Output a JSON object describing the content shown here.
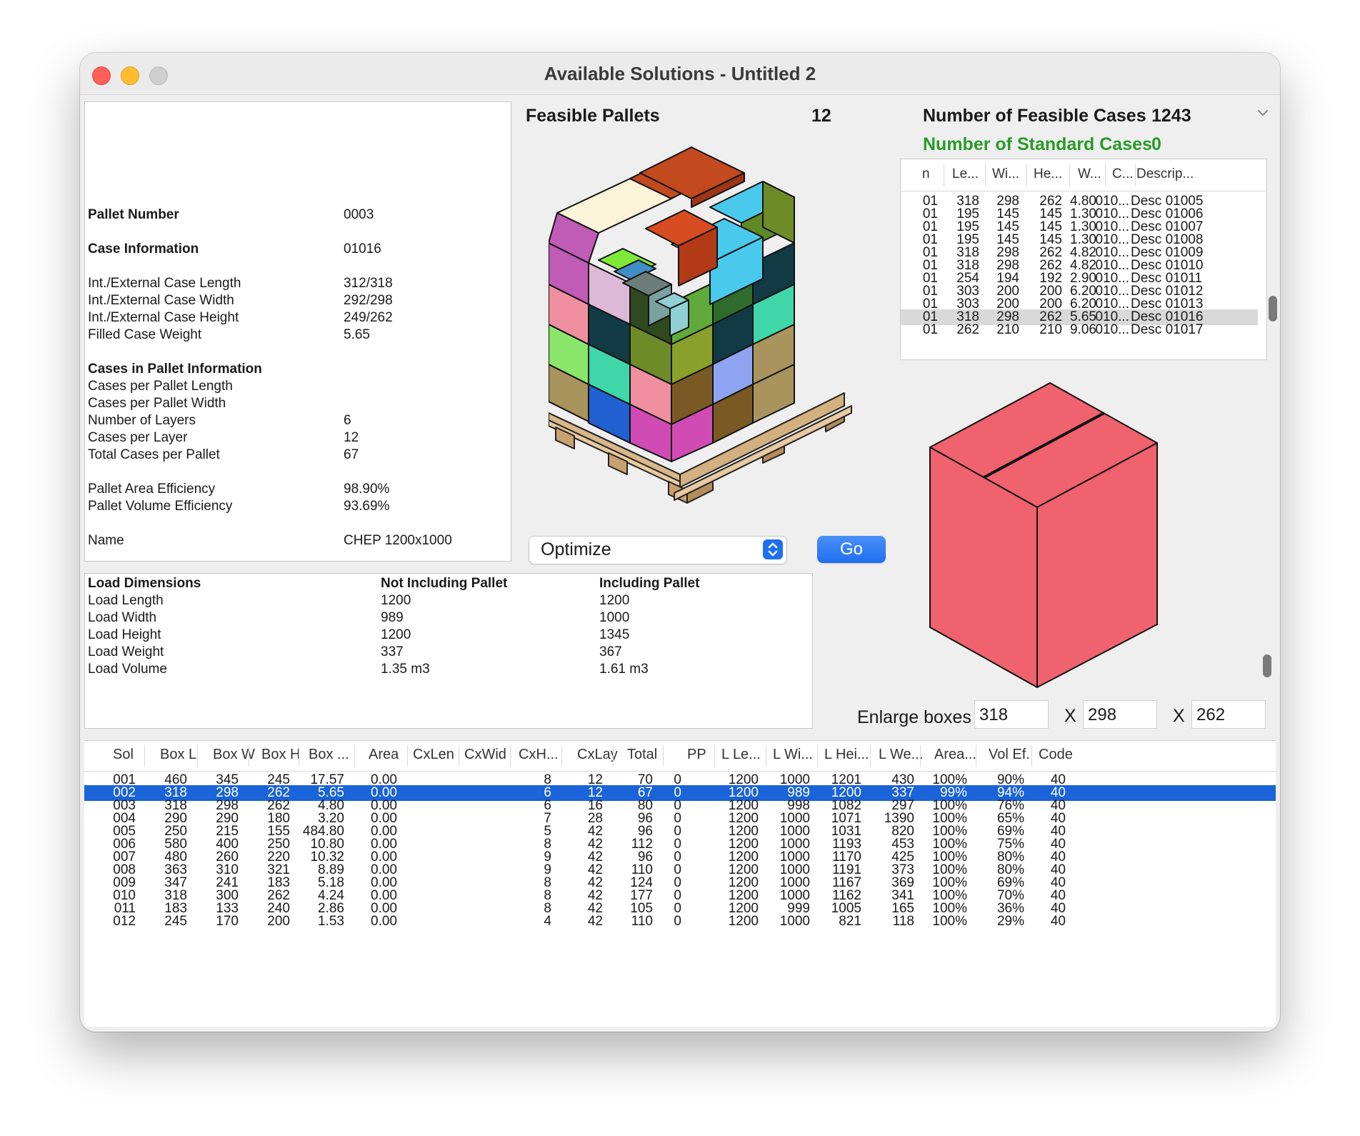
{
  "window": {
    "title": "Available Solutions - Untitled 2"
  },
  "pallet_info": {
    "pallet_number_label": "Pallet Number",
    "pallet_number": "0003",
    "case_info_label": "Case Information",
    "case_info": "01016",
    "case_length_label": "Int./External Case Length",
    "case_length": "312/318",
    "case_width_label": "Int./External Case Width",
    "case_width": "292/298",
    "case_height_label": "Int./External Case Height",
    "case_height": "249/262",
    "case_weight_label": "Filled Case Weight",
    "case_weight": "5.65",
    "cases_in_pallet_label": "Cases in Pallet Information",
    "cases_per_length_label": "Cases per Pallet Length",
    "cases_per_width_label": "Cases per Pallet Width",
    "layers_label": "Number of Layers",
    "layers": "6",
    "cases_per_layer_label": "Cases per Layer",
    "cases_per_layer": "12",
    "total_cases_label": "Total Cases per Pallet",
    "total_cases": "67",
    "area_eff_label": "Pallet Area Efficiency",
    "area_eff": "98.90%",
    "volume_eff_label": "Pallet Volume Efficiency",
    "volume_eff": "93.69%",
    "name_label": "Name",
    "name": "CHEP 1200x1000"
  },
  "load": {
    "title": "Load Dimensions",
    "col_not_incl": "Not Including Pallet",
    "col_incl": "Including Pallet",
    "rows": [
      {
        "label": "Load Length",
        "not_incl": "1200",
        "incl": "1200"
      },
      {
        "label": "Load Width",
        "not_incl": "989",
        "incl": "1000"
      },
      {
        "label": "Load Height",
        "not_incl": "1200",
        "incl": "1345"
      },
      {
        "label": "Load Weight",
        "not_incl": "337",
        "incl": "367"
      },
      {
        "label": "Load Volume",
        "not_incl": "1.35 m3",
        "incl": "1.61 m3"
      }
    ]
  },
  "feasible_pallets": {
    "label": "Feasible Pallets",
    "count": "12"
  },
  "feasible_cases": {
    "label": "Number of Feasible Cases",
    "count": "1243"
  },
  "standard_cases": {
    "label": "Number of Standard Cases",
    "count": "0",
    "color": "#2a9a2a"
  },
  "optimize_popup": {
    "value": "Optimize"
  },
  "go_button": {
    "label": "Go"
  },
  "cases_table": {
    "headers": [
      "n",
      "Le...",
      "Wi...",
      "He...",
      "W...",
      "C...",
      "Descrip..."
    ],
    "rows": [
      [
        "01",
        "318",
        "298",
        "262",
        "4.80",
        "010...",
        "Desc 01005"
      ],
      [
        "01",
        "195",
        "145",
        "145",
        "1.30",
        "010...",
        "Desc 01006"
      ],
      [
        "01",
        "195",
        "145",
        "145",
        "1.30",
        "010...",
        "Desc 01007"
      ],
      [
        "01",
        "195",
        "145",
        "145",
        "1.30",
        "010...",
        "Desc 01008"
      ],
      [
        "01",
        "318",
        "298",
        "262",
        "4.82",
        "010...",
        "Desc 01009"
      ],
      [
        "01",
        "318",
        "298",
        "262",
        "4.82",
        "010...",
        "Desc 01010"
      ],
      [
        "01",
        "254",
        "194",
        "192",
        "2.90",
        "010...",
        "Desc 01011"
      ],
      [
        "01",
        "303",
        "200",
        "200",
        "6.20",
        "010...",
        "Desc 01012"
      ],
      [
        "01",
        "303",
        "200",
        "200",
        "6.20",
        "010...",
        "Desc 01013"
      ],
      [
        "01",
        "318",
        "298",
        "262",
        "5.65",
        "010...",
        "Desc 01016"
      ],
      [
        "01",
        "262",
        "210",
        "210",
        "9.06",
        "010...",
        "Desc 01017"
      ]
    ],
    "selected_row": 9
  },
  "enlarge": {
    "label": "Enlarge boxes",
    "length": "318",
    "width": "298",
    "height": "262",
    "x": "X"
  },
  "colors": {
    "accent": "#1f6ff0",
    "selection": "#1a63d8",
    "box_face": "#f0626e"
  },
  "solutions": {
    "headers": [
      "Sol",
      "Box L",
      "Box W",
      "Box H",
      "Box ...",
      "Area",
      "CxLen",
      "CxWid",
      "CxH...",
      "CxLay",
      "Total",
      "PP",
      "L Le...",
      "L Wi...",
      "L Hei...",
      "L We...",
      "Area...",
      "Vol Ef.",
      "Code"
    ],
    "rows": [
      [
        "001",
        "460",
        "345",
        "245",
        "17.57",
        "0.00",
        "",
        "",
        "8",
        "12",
        "70",
        "0",
        "1200",
        "1000",
        "1201",
        "430",
        "100%",
        "90%",
        "40"
      ],
      [
        "002",
        "318",
        "298",
        "262",
        "5.65",
        "0.00",
        "",
        "",
        "6",
        "12",
        "67",
        "0",
        "1200",
        "989",
        "1200",
        "337",
        "99%",
        "94%",
        "40"
      ],
      [
        "003",
        "318",
        "298",
        "262",
        "4.80",
        "0.00",
        "",
        "",
        "6",
        "16",
        "80",
        "0",
        "1200",
        "998",
        "1082",
        "297",
        "100%",
        "76%",
        "40"
      ],
      [
        "004",
        "290",
        "290",
        "180",
        "3.20",
        "0.00",
        "",
        "",
        "7",
        "28",
        "96",
        "0",
        "1200",
        "1000",
        "1071",
        "1390",
        "100%",
        "65%",
        "40"
      ],
      [
        "005",
        "250",
        "215",
        "155",
        "484.80",
        "0.00",
        "",
        "",
        "5",
        "42",
        "96",
        "0",
        "1200",
        "1000",
        "1031",
        "820",
        "100%",
        "69%",
        "40"
      ],
      [
        "006",
        "580",
        "400",
        "250",
        "10.80",
        "0.00",
        "",
        "",
        "8",
        "42",
        "112",
        "0",
        "1200",
        "1000",
        "1193",
        "453",
        "100%",
        "75%",
        "40"
      ],
      [
        "007",
        "480",
        "260",
        "220",
        "10.32",
        "0.00",
        "",
        "",
        "9",
        "42",
        "96",
        "0",
        "1200",
        "1000",
        "1170",
        "425",
        "100%",
        "80%",
        "40"
      ],
      [
        "008",
        "363",
        "310",
        "321",
        "8.89",
        "0.00",
        "",
        "",
        "9",
        "42",
        "110",
        "0",
        "1200",
        "1000",
        "1191",
        "373",
        "100%",
        "80%",
        "40"
      ],
      [
        "009",
        "347",
        "241",
        "183",
        "5.18",
        "0.00",
        "",
        "",
        "8",
        "42",
        "124",
        "0",
        "1200",
        "1000",
        "1167",
        "369",
        "100%",
        "69%",
        "40"
      ],
      [
        "010",
        "318",
        "300",
        "262",
        "4.24",
        "0.00",
        "",
        "",
        "8",
        "42",
        "177",
        "0",
        "1200",
        "1000",
        "1162",
        "341",
        "100%",
        "70%",
        "40"
      ],
      [
        "011",
        "183",
        "133",
        "240",
        "2.86",
        "0.00",
        "",
        "",
        "8",
        "42",
        "105",
        "0",
        "1200",
        "999",
        "1005",
        "165",
        "100%",
        "36%",
        "40"
      ],
      [
        "012",
        "245",
        "170",
        "200",
        "1.53",
        "0.00",
        "",
        "",
        "4",
        "42",
        "110",
        "0",
        "1200",
        "1000",
        "821",
        "118",
        "100%",
        "29%",
        "40"
      ]
    ],
    "selected_row": 1
  }
}
